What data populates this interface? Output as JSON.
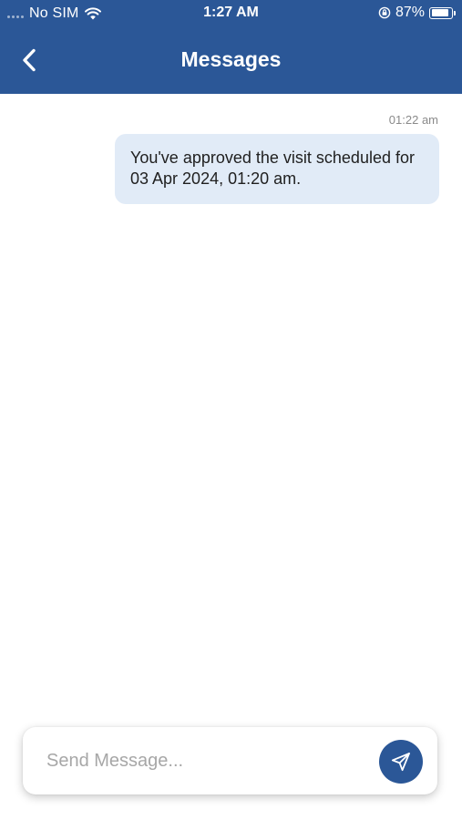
{
  "status_bar": {
    "carrier": "No SIM",
    "time": "1:27 AM",
    "battery_percent": "87%",
    "battery_level": 0.87,
    "icons": [
      "signal-dots-icon",
      "wifi-icon",
      "orientation-lock-icon",
      "battery-icon"
    ]
  },
  "header": {
    "back_icon": "chevron-left-icon",
    "title": "Messages"
  },
  "messages": [
    {
      "time": "01:22 am",
      "text": "You've approved the visit scheduled for 03 Apr 2024, 01:20 am.",
      "direction": "outgoing"
    }
  ],
  "composer": {
    "value": "",
    "placeholder": "Send Message...",
    "send_icon": "send-icon"
  },
  "colors": {
    "primary": "#2b5797",
    "bubble": "#e1ebf7",
    "timestamp": "#8a8a8a",
    "placeholder": "#a7a7a7"
  }
}
